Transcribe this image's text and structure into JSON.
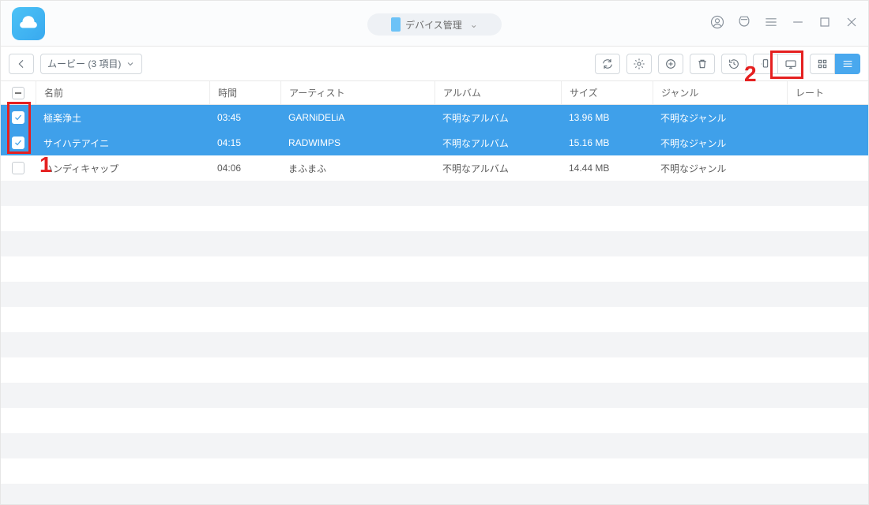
{
  "header": {
    "pill_label": "デバイス管理"
  },
  "toolbar": {
    "crumb_label": "ムービー (3 項目)"
  },
  "columns": {
    "name": "名前",
    "time": "時間",
    "artist": "アーティスト",
    "album": "アルバム",
    "size": "サイズ",
    "genre": "ジャンル",
    "rate": "レート"
  },
  "rows": [
    {
      "selected": true,
      "name": "極楽浄土",
      "time": "03:45",
      "artist": "GARNiDELiA",
      "album": "不明なアルバム",
      "size": "13.96 MB",
      "genre": "不明なジャンル"
    },
    {
      "selected": true,
      "name": "サイハテアイニ",
      "time": "04:15",
      "artist": "RADWIMPS",
      "album": "不明なアルバム",
      "size": "15.16 MB",
      "genre": "不明なジャンル"
    },
    {
      "selected": false,
      "name": "ハンディキャップ",
      "time": "04:06",
      "artist": "まふまふ",
      "album": "不明なアルバム",
      "size": "14.44 MB",
      "genre": "不明なジャンル"
    }
  ],
  "annotations": {
    "label1": "1",
    "label2": "2"
  }
}
